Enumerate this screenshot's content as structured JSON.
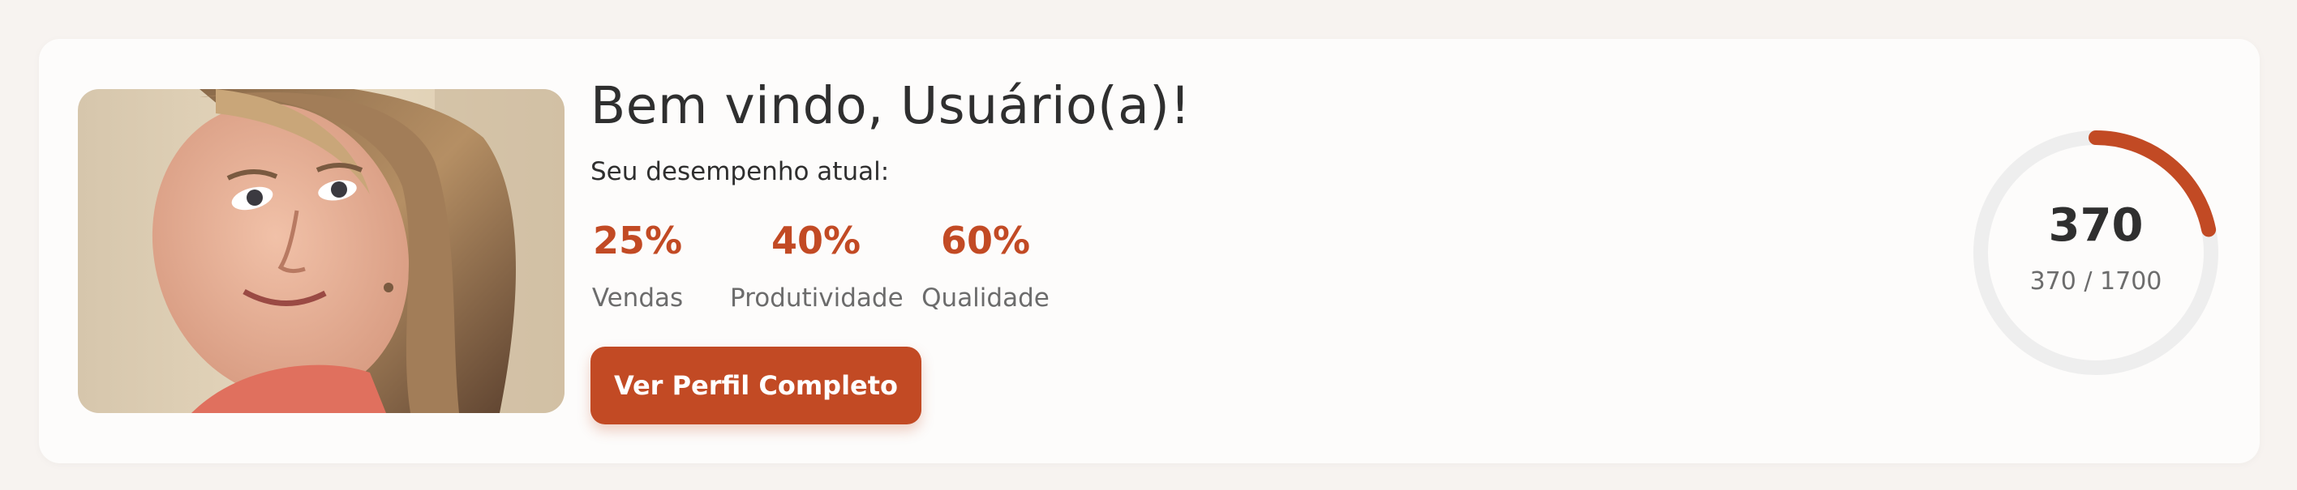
{
  "welcome": {
    "title": "Bem vindo, Usuário(a)!",
    "subtitle": "Seu desempenho atual:"
  },
  "metrics": [
    {
      "value": "25%",
      "label": "Vendas"
    },
    {
      "value": "40%",
      "label": "Produtividade"
    },
    {
      "value": "60%",
      "label": "Qualidade"
    }
  ],
  "profile_button": {
    "label": "Ver Perfil Completo"
  },
  "progress": {
    "value": "370",
    "summary": "370 / 1700",
    "current": 370,
    "max": 1700
  },
  "colors": {
    "accent": "#c24a24",
    "track": "#eeeeee"
  }
}
